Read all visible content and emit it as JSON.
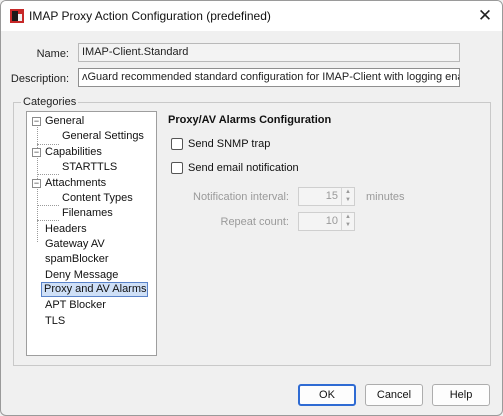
{
  "window": {
    "title": "IMAP Proxy Action Configuration (predefined)",
    "close_glyph": "✕",
    "app_icon": "watchguard-app-icon"
  },
  "form": {
    "name_label": "Name:",
    "name_value": "IMAP-Client.Standard",
    "description_label": "Description:",
    "description_value": "ʌGuard recommended standard configuration for IMAP-Client with logging enabled"
  },
  "categories": {
    "legend": "Categories",
    "items": [
      {
        "label": "General",
        "expander": "−"
      },
      {
        "label": "General Settings"
      },
      {
        "label": "Capabilities",
        "expander": "−"
      },
      {
        "label": "STARTTLS"
      },
      {
        "label": "Attachments",
        "expander": "−"
      },
      {
        "label": "Content Types"
      },
      {
        "label": "Filenames"
      },
      {
        "label": "Headers"
      },
      {
        "label": "Gateway AV"
      },
      {
        "label": "spamBlocker"
      },
      {
        "label": "Deny Message"
      },
      {
        "label": "Proxy and AV Alarms",
        "selected": true
      },
      {
        "label": "APT Blocker"
      },
      {
        "label": "TLS"
      }
    ]
  },
  "alarms": {
    "title": "Proxy/AV Alarms Configuration",
    "send_snmp_label": "Send SNMP trap",
    "send_snmp_checked": false,
    "send_email_label": "Send email notification",
    "send_email_checked": false,
    "interval_label": "Notification interval:",
    "interval_value": "15",
    "interval_unit": "minutes",
    "repeat_label": "Repeat count:",
    "repeat_value": "10",
    "spin_up": "▲",
    "spin_down": "▼"
  },
  "buttons": {
    "ok": "OK",
    "cancel": "Cancel",
    "help": "Help"
  },
  "colors": {
    "selection": "#cfe0f7",
    "default_button_border": "#2f6bd3",
    "disabled_text": "#9a9a9a"
  }
}
